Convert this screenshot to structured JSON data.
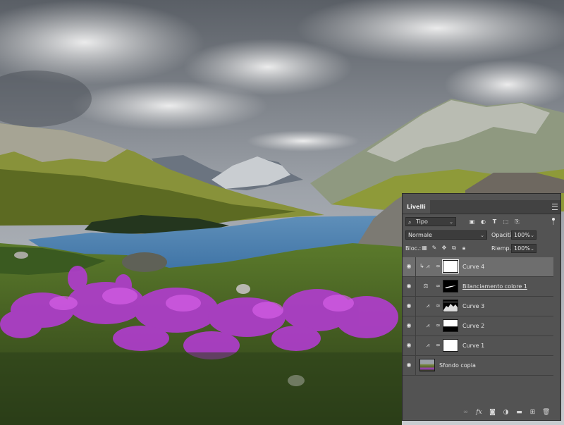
{
  "layers_panel": {
    "tab_label": "Livelli",
    "collapse_glyph": "«",
    "close_glyph": "×",
    "filter": {
      "label": "Tipo"
    },
    "blend_mode": "Normale",
    "opacity_label": "Opacità:",
    "opacity_value": "100%",
    "lock_label": "Bloc.:",
    "fill_label": "Riemp.:",
    "fill_value": "100%",
    "layers": [
      {
        "name": "Curve 4",
        "type": "curves",
        "mask": "white",
        "selected": true,
        "clipped": true
      },
      {
        "name": "Bilanciamento colore 1",
        "type": "color-balance",
        "mask": "black-with-white-streak",
        "selected": false,
        "clipped": false
      },
      {
        "name": "Curve 3",
        "type": "curves",
        "mask": "black-with-white-mountains",
        "selected": false,
        "clipped": false
      },
      {
        "name": "Curve 2",
        "type": "curves",
        "mask": "white-top-black-bottom",
        "selected": false,
        "clipped": false
      },
      {
        "name": "Curve 1",
        "type": "curves",
        "mask": "white",
        "selected": false,
        "clipped": false
      },
      {
        "name": "Sfondo copia",
        "type": "pixel",
        "mask": "",
        "selected": false,
        "clipped": false
      }
    ],
    "bottom_icons": [
      "link-layers-icon",
      "fx-icon",
      "add-mask-icon",
      "adjustment-layer-icon",
      "new-group-icon",
      "new-layer-icon",
      "delete-layer-icon"
    ],
    "fx_label": "fx"
  },
  "colors": {
    "panel_bg": "#535353",
    "selected_row": "#6e6e6e",
    "flowers": "#b23ad0",
    "lake": "#4b84b4"
  }
}
